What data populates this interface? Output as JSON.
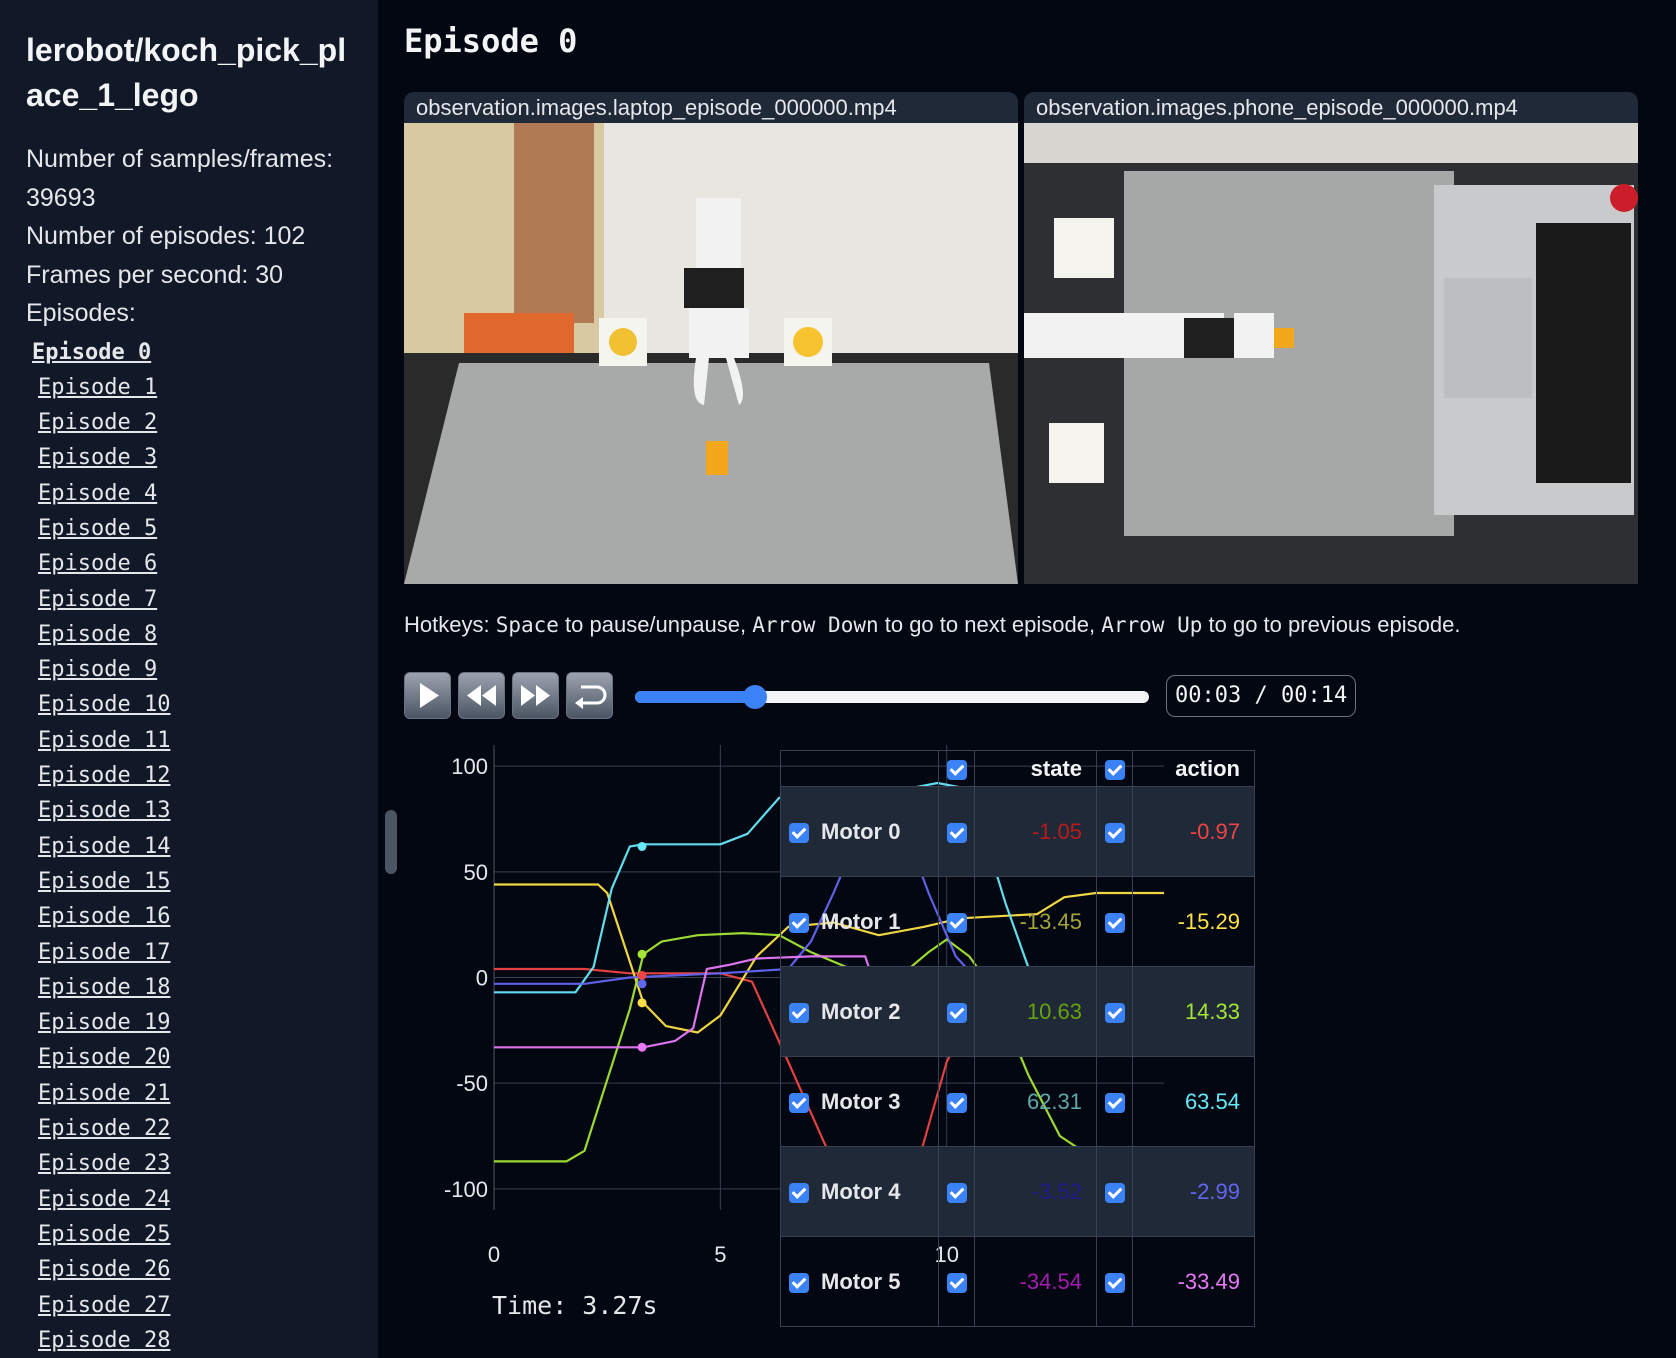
{
  "sidebar": {
    "dataset_title": "lerobot/koch_pick_place_1_lego",
    "info": [
      "Number of samples/frames: 39693",
      "Number of episodes: 102",
      "Frames per second: 30"
    ],
    "episodes_label": "Episodes:",
    "episodes": [
      "Episode 0",
      "Episode 1",
      "Episode 2",
      "Episode 3",
      "Episode 4",
      "Episode 5",
      "Episode 6",
      "Episode 7",
      "Episode 8",
      "Episode 9",
      "Episode 10",
      "Episode 11",
      "Episode 12",
      "Episode 13",
      "Episode 14",
      "Episode 15",
      "Episode 16",
      "Episode 17",
      "Episode 18",
      "Episode 19",
      "Episode 20",
      "Episode 21",
      "Episode 22",
      "Episode 23",
      "Episode 24",
      "Episode 25",
      "Episode 26",
      "Episode 27",
      "Episode 28"
    ],
    "active_episode": 0
  },
  "main": {
    "heading": "Episode 0",
    "videos": [
      {
        "name": "observation.images.laptop_episode_000000.mp4"
      },
      {
        "name": "observation.images.phone_episode_000000.mp4"
      }
    ],
    "hotkeys": {
      "prefix": "Hotkeys: ",
      "k1": "Space",
      "t1": " to pause/unpause, ",
      "k2": "Arrow Down",
      "t2": " to go to next episode, ",
      "k3": "Arrow Up",
      "t3": " to go to previous episode."
    },
    "controls": {
      "play_icon": "play-icon",
      "rewind_icon": "rewind-icon",
      "forward_icon": "fast-forward-icon",
      "restart_icon": "restart-icon",
      "progress": 0.234,
      "time_display": "00:03 / 00:14"
    },
    "time_readout": "Time: 3.27s"
  },
  "table": {
    "header": {
      "state": "state",
      "action": "action"
    },
    "rows": [
      {
        "name": "Motor 0",
        "state": "-1.05",
        "action": "-0.97",
        "state_color": "#b91c1c",
        "action_color": "#ef4444"
      },
      {
        "name": "Motor 1",
        "state": "-13.45",
        "action": "-15.29",
        "state_color": "#a3a33a",
        "action_color": "#fde047"
      },
      {
        "name": "Motor 2",
        "state": "10.63",
        "action": "14.33",
        "state_color": "#65a30d",
        "action_color": "#a3e635"
      },
      {
        "name": "Motor 3",
        "state": "62.31",
        "action": "63.54",
        "state_color": "#5fa8a8",
        "action_color": "#67e8f9"
      },
      {
        "name": "Motor 4",
        "state": "-3.52",
        "action": "-2.99",
        "state_color": "#1e1b8b",
        "action_color": "#6366f1"
      },
      {
        "name": "Motor 5",
        "state": "-34.54",
        "action": "-33.49",
        "state_color": "#a21caf",
        "action_color": "#e879f9"
      }
    ]
  },
  "chart_data": {
    "type": "line",
    "xlim": [
      0,
      14.8
    ],
    "ylim": [
      -110,
      110
    ],
    "x_ticks": [
      "0",
      "5",
      "10"
    ],
    "y_ticks": [
      "100",
      "50",
      "0",
      "-50",
      "-100"
    ],
    "grid": true,
    "cursor_x": 3.27,
    "series": [
      {
        "color": "#ef4444",
        "points": [
          [
            0,
            4
          ],
          [
            2,
            4
          ],
          [
            3,
            2
          ],
          [
            5,
            2
          ],
          [
            5.7,
            -2
          ],
          [
            6.5,
            -40
          ],
          [
            7.5,
            -88
          ],
          [
            8,
            -96
          ],
          [
            9,
            -96
          ],
          [
            9.4,
            -85
          ],
          [
            10,
            -40
          ],
          [
            10.8,
            -6
          ],
          [
            11.5,
            -2
          ],
          [
            13,
            0
          ],
          [
            14.8,
            2
          ]
        ]
      },
      {
        "color": "#fde047",
        "points": [
          [
            0,
            44
          ],
          [
            1.5,
            44
          ],
          [
            2.3,
            44
          ],
          [
            2.5,
            40
          ],
          [
            3.3,
            -12
          ],
          [
            3.8,
            -23
          ],
          [
            4.5,
            -26
          ],
          [
            5,
            -18
          ],
          [
            5.8,
            10
          ],
          [
            6.5,
            24
          ],
          [
            7.5,
            26
          ],
          [
            8.5,
            20
          ],
          [
            9.5,
            24
          ],
          [
            10.3,
            28
          ],
          [
            12,
            30
          ],
          [
            12.6,
            38
          ],
          [
            13.3,
            40
          ],
          [
            14.8,
            40
          ]
        ]
      },
      {
        "color": "#a3e635",
        "points": [
          [
            0,
            -87
          ],
          [
            1.6,
            -87
          ],
          [
            2,
            -82
          ],
          [
            3,
            -15
          ],
          [
            3.3,
            11
          ],
          [
            3.7,
            17
          ],
          [
            4.5,
            20
          ],
          [
            5.5,
            21
          ],
          [
            6.3,
            20
          ],
          [
            7,
            12
          ],
          [
            8,
            3
          ],
          [
            8.6,
            -6
          ],
          [
            9.1,
            3
          ],
          [
            9.6,
            12
          ],
          [
            10,
            18
          ],
          [
            10.5,
            10
          ],
          [
            11,
            -5
          ],
          [
            11.8,
            -46
          ],
          [
            12.5,
            -75
          ],
          [
            13.2,
            -85
          ],
          [
            14.8,
            -85
          ]
        ]
      },
      {
        "color": "#67e8f9",
        "points": [
          [
            0,
            -7
          ],
          [
            1.8,
            -7
          ],
          [
            2.2,
            5
          ],
          [
            2.6,
            42
          ],
          [
            3,
            62
          ],
          [
            3.3,
            63
          ],
          [
            4.5,
            63
          ],
          [
            5,
            63
          ],
          [
            5.6,
            68
          ],
          [
            6.3,
            85
          ],
          [
            7,
            89
          ],
          [
            7.5,
            90
          ],
          [
            8.2,
            89
          ],
          [
            8.8,
            84
          ],
          [
            9.3,
            90
          ],
          [
            9.8,
            92
          ],
          [
            10.3,
            90
          ],
          [
            10.8,
            70
          ],
          [
            11.3,
            35
          ],
          [
            11.8,
            5
          ],
          [
            12.5,
            -15
          ],
          [
            13.2,
            -17
          ],
          [
            14.8,
            -15
          ]
        ]
      },
      {
        "color": "#6366f1",
        "points": [
          [
            0,
            -3
          ],
          [
            2,
            -3
          ],
          [
            3,
            0
          ],
          [
            5,
            2
          ],
          [
            6.5,
            4
          ],
          [
            7,
            17
          ],
          [
            7.5,
            40
          ],
          [
            7.9,
            60
          ],
          [
            8.3,
            63
          ],
          [
            9.2,
            63
          ],
          [
            9.6,
            40
          ],
          [
            10.2,
            10
          ],
          [
            10.8,
            -4
          ],
          [
            11.5,
            -1
          ],
          [
            13,
            2
          ],
          [
            14.8,
            2
          ]
        ]
      },
      {
        "color": "#e879f9",
        "points": [
          [
            0,
            -33
          ],
          [
            2,
            -33
          ],
          [
            3.3,
            -33
          ],
          [
            4,
            -30
          ],
          [
            4.4,
            -24
          ],
          [
            4.7,
            4
          ],
          [
            5.2,
            6
          ],
          [
            5.8,
            9
          ],
          [
            7,
            10
          ],
          [
            8.2,
            10
          ],
          [
            8.4,
            -3
          ],
          [
            8.7,
            -25
          ],
          [
            9.5,
            -26
          ],
          [
            10.5,
            -29
          ],
          [
            12,
            -32
          ],
          [
            14.8,
            -33
          ]
        ]
      }
    ],
    "markers": [
      {
        "x": 3.27,
        "y": 62,
        "color": "#67e8f9"
      },
      {
        "x": 3.27,
        "y": 11,
        "color": "#a3e635"
      },
      {
        "x": 3.27,
        "y": 1,
        "color": "#ef4444"
      },
      {
        "x": 3.27,
        "y": -3,
        "color": "#6366f1"
      },
      {
        "x": 3.27,
        "y": -12,
        "color": "#fde047"
      },
      {
        "x": 3.27,
        "y": -33,
        "color": "#e879f9"
      }
    ]
  }
}
